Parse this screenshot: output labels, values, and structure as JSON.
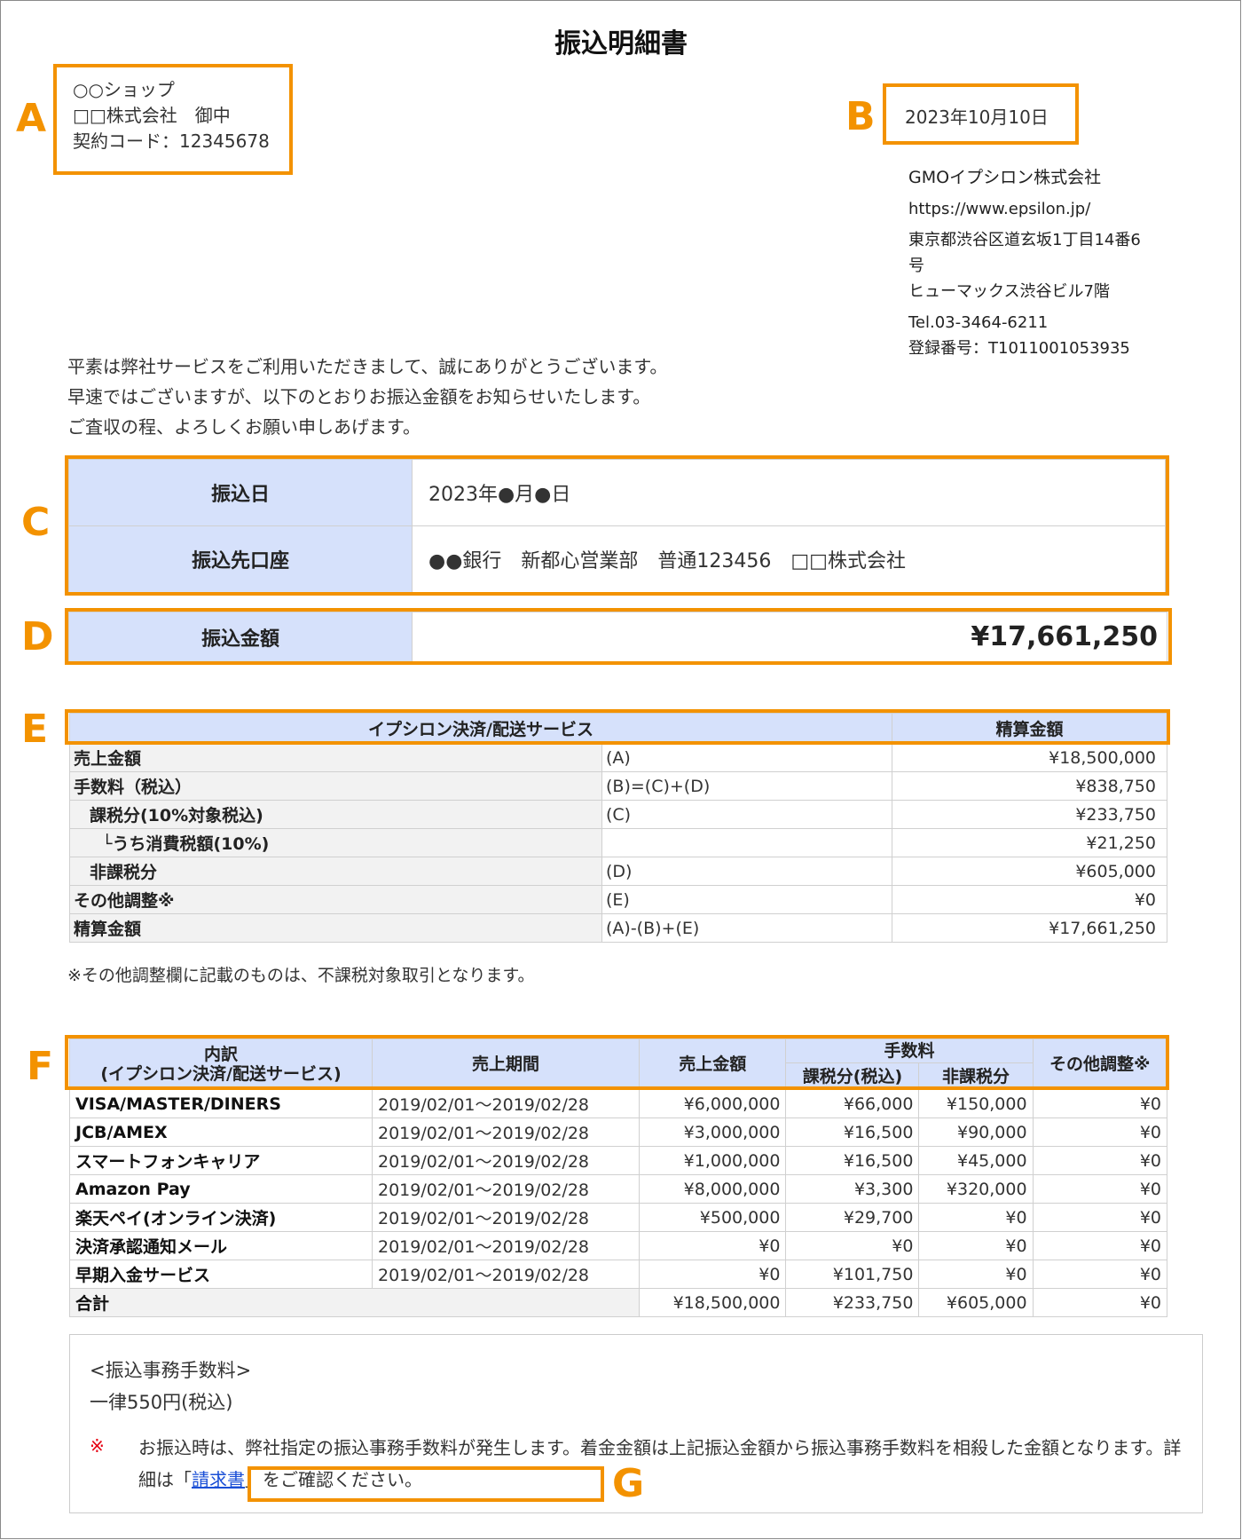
{
  "document": {
    "title": "振込明細書",
    "recipient": [
      "○○ショップ",
      "□□株式会社　御中",
      "契約コード：12345678"
    ],
    "issue_date": "2023年10月10日",
    "issuer": {
      "name": "GMOイプシロン株式会社",
      "url": "https://www.epsilon.jp/",
      "address_line1": "東京都渋谷区道玄坂1丁目14番6",
      "address_line1b": "号",
      "address_line2": "ヒューマックス渋谷ビル7階",
      "tel": "Tel.03-3464-6211",
      "registration": "登録番号：T1011001053935"
    },
    "greeting": [
      "平素は弊社サービスをご利用いただきまして、誠にありがとうございます。",
      "早速ではございますが、以下のとおりお振込金額をお知らせいたします。",
      "ご査収の程、よろしくお願い申しあげます。"
    ]
  },
  "callouts": {
    "a": "A",
    "b": "B",
    "c": "C",
    "d": "D",
    "e": "E",
    "f": "F",
    "g": "G"
  },
  "transfer": {
    "date_label": "振込日",
    "date_value": "2023年●月●日",
    "account_label": "振込先口座",
    "account_value": "●●銀行　新都心営業部　普通123456　□□株式会社",
    "amount_label": "振込金額",
    "amount_value": "¥17,661,250"
  },
  "settlement": {
    "headers": [
      "イプシロン決済/配送サービス",
      "精算金額"
    ],
    "rows": [
      {
        "label": "売上金額",
        "formula": "(A)",
        "amount": "¥18,500,000"
      },
      {
        "label": "手数料（税込）",
        "formula": "(B)=(C)+(D)",
        "amount": "¥838,750"
      },
      {
        "label": "課税分(10%対象税込)",
        "formula": "(C)",
        "amount": "¥233,750"
      },
      {
        "label": "└うち消費税額(10%)",
        "formula": "",
        "amount": "¥21,250"
      },
      {
        "label": "非課税分",
        "formula": "(D)",
        "amount": "¥605,000"
      },
      {
        "label": "その他調整※",
        "formula": "(E)",
        "amount": "¥0"
      },
      {
        "label": "精算金額",
        "formula": "(A)-(B)+(E)",
        "amount": "¥17,661,250"
      }
    ],
    "note": "※その他調整欄に記載のものは、不課税対象取引となります。"
  },
  "breakdown": {
    "headers": {
      "item_line1": "内訳",
      "item_line2": "(イプシロン決済/配送サービス)",
      "period": "売上期間",
      "sales": "売上金額",
      "fee": "手数料",
      "fee_taxable": "課税分(税込)",
      "fee_nontaxable": "非課税分",
      "other": "その他調整※"
    },
    "rows": [
      {
        "name": "VISA/MASTER/DINERS",
        "period": "2019/02/01～2019/02/28",
        "sales": "¥6,000,000",
        "taxable": "¥66,000",
        "nontaxable": "¥150,000",
        "other": "¥0"
      },
      {
        "name": "JCB/AMEX",
        "period": "2019/02/01～2019/02/28",
        "sales": "¥3,000,000",
        "taxable": "¥16,500",
        "nontaxable": "¥90,000",
        "other": "¥0"
      },
      {
        "name": "スマートフォンキャリア",
        "period": "2019/02/01～2019/02/28",
        "sales": "¥1,000,000",
        "taxable": "¥16,500",
        "nontaxable": "¥45,000",
        "other": "¥0"
      },
      {
        "name": "Amazon Pay",
        "period": "2019/02/01～2019/02/28",
        "sales": "¥8,000,000",
        "taxable": "¥3,300",
        "nontaxable": "¥320,000",
        "other": "¥0"
      },
      {
        "name": "楽天ペイ(オンライン決済)",
        "period": "2019/02/01～2019/02/28",
        "sales": "¥500,000",
        "taxable": "¥29,700",
        "nontaxable": "¥0",
        "other": "¥0"
      },
      {
        "name": "決済承認通知メール",
        "period": "2019/02/01～2019/02/28",
        "sales": "¥0",
        "taxable": "¥0",
        "nontaxable": "¥0",
        "other": "¥0"
      },
      {
        "name": "早期入金サービス",
        "period": "2019/02/01～2019/02/28",
        "sales": "¥0",
        "taxable": "¥101,750",
        "nontaxable": "¥0",
        "other": "¥0"
      }
    ],
    "total": {
      "name": "合計",
      "sales": "¥18,500,000",
      "taxable": "¥233,750",
      "nontaxable": "¥605,000",
      "other": "¥0"
    }
  },
  "fee_box": {
    "heading": "<振込事務手数料>",
    "fee": "一律550円(税込)",
    "mark": "※",
    "text_before": "お振込時は、弊社指定の振込事務手数料が発生します。着金金額は上記振込金額から振込事務手数料を相殺した金額となります。",
    "detail_prefix": "詳細は「",
    "detail_link": "請求書",
    "detail_suffix": "」をご確認ください。"
  },
  "colors": {
    "callout": "#f39200",
    "header_bg": "#d6e1fb",
    "label_bg": "#f2f2f2",
    "link": "#1a4fd6",
    "mark": "#e60012"
  }
}
